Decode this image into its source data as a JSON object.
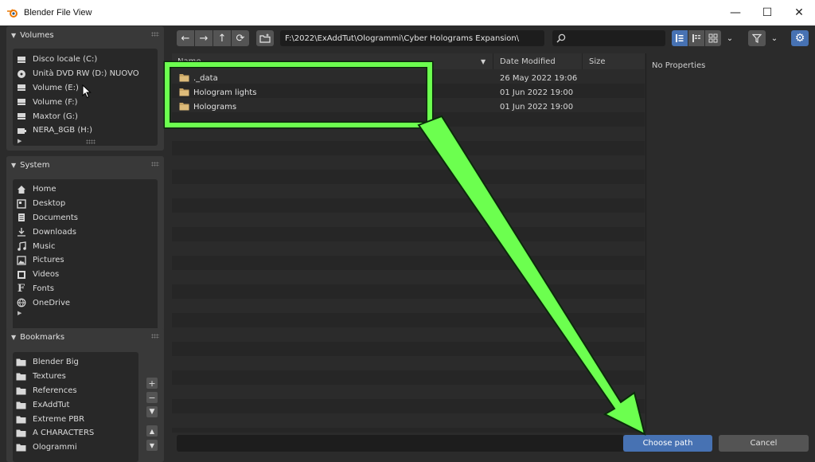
{
  "window": {
    "title": "Blender File View",
    "minimize": "—",
    "maximize": "☐",
    "close": "✕"
  },
  "volumes": {
    "header": "Volumes",
    "items": [
      {
        "label": "Disco locale (C:)",
        "icon": "drive-icon"
      },
      {
        "label": "Unità DVD RW (D:) NUOVO",
        "icon": "disc-icon"
      },
      {
        "label": "Volume (E:)",
        "icon": "drive-icon"
      },
      {
        "label": "Volume (F:)",
        "icon": "drive-icon"
      },
      {
        "label": "Maxtor (G:)",
        "icon": "drive-icon"
      },
      {
        "label": "NERA_8GB (H:)",
        "icon": "usb-icon"
      }
    ]
  },
  "system": {
    "header": "System",
    "items": [
      {
        "label": "Home",
        "icon": "home-icon"
      },
      {
        "label": "Desktop",
        "icon": "desktop-icon"
      },
      {
        "label": "Documents",
        "icon": "documents-icon"
      },
      {
        "label": "Downloads",
        "icon": "downloads-icon"
      },
      {
        "label": "Music",
        "icon": "music-icon"
      },
      {
        "label": "Pictures",
        "icon": "pictures-icon"
      },
      {
        "label": "Videos",
        "icon": "videos-icon"
      },
      {
        "label": "Fonts",
        "icon": "fonts-icon"
      },
      {
        "label": "OneDrive",
        "icon": "onedrive-icon"
      }
    ]
  },
  "bookmarks": {
    "header": "Bookmarks",
    "items": [
      {
        "label": "Blender Big"
      },
      {
        "label": "Textures"
      },
      {
        "label": "References"
      },
      {
        "label": "ExAddTut"
      },
      {
        "label": "Extreme PBR"
      },
      {
        "label": "A CHARACTERS"
      },
      {
        "label": "Ologrammi"
      }
    ]
  },
  "toolbar": {
    "path": "F:\\2022\\ExAddTut\\Ologrammi\\Cyber Holograms Expansion\\",
    "search_value": ""
  },
  "filelist": {
    "col_name": "Name",
    "col_date": "Date Modified",
    "col_size": "Size",
    "rows": [
      {
        "name": "._data",
        "date": "26 May 2022 19:06"
      },
      {
        "name": "Hologram lights",
        "date": "01 Jun 2022 19:00"
      },
      {
        "name": "Holograms",
        "date": "01 Jun 2022 19:00"
      }
    ]
  },
  "properties": {
    "text": "No Properties"
  },
  "footer": {
    "filename_value": "",
    "choose_label": "Choose path",
    "cancel_label": "Cancel"
  },
  "colors": {
    "accent": "#4772b3",
    "highlight": "#6cff4f",
    "folder": "#c8a565"
  }
}
